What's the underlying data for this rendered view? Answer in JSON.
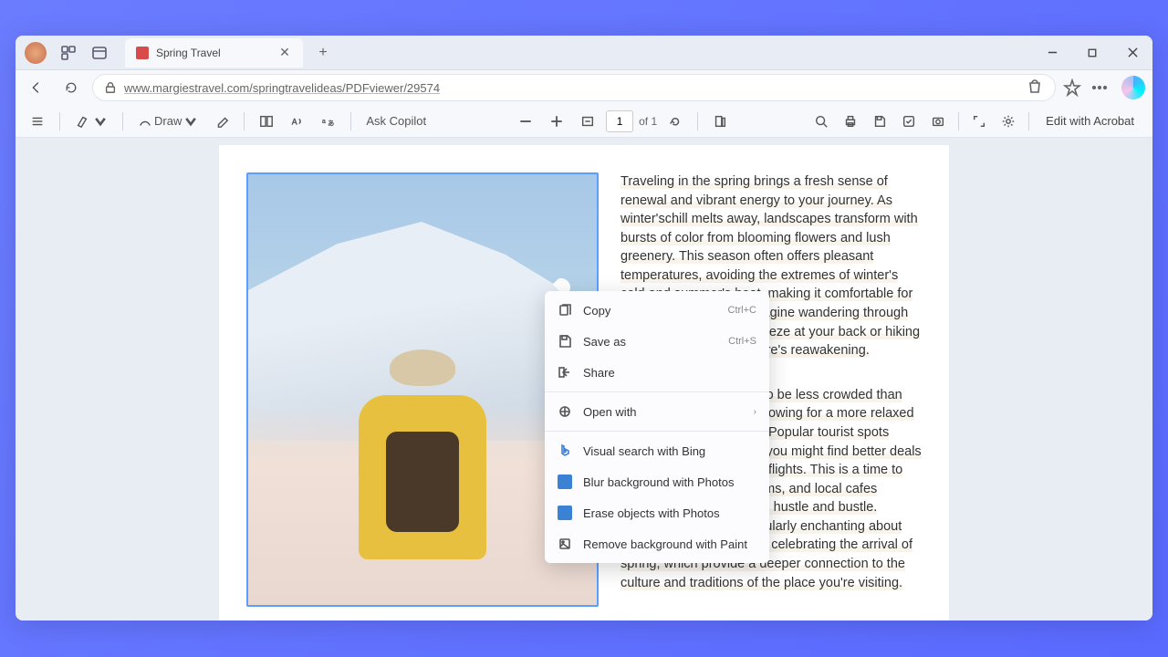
{
  "tab": {
    "title": "Spring Travel"
  },
  "url": "www.margiestravel.com/springtravelideas/PDFviewer/29574",
  "toolbar": {
    "draw_label": "Draw",
    "ask_copilot": "Ask Copilot",
    "page_current": "1",
    "page_of": "of 1",
    "edit_acrobat": "Edit with Acrobat"
  },
  "document": {
    "para1": "Traveling in the spring brings a fresh sense of renewal and vibrant energy to your journey. As winter'schill melts away, landscapes transform with bursts of color from blooming flowers and lush greenery. This season often offers pleasant temperatures, avoiding the extremes of winter's cold and summer's heat, making it comfortable for outdoor explorations. Imagine wandering through gardens with a gentle breeze at your back or hiking trails surrounded by nature's reawakening.",
    "para2": "Spring travel also tends to be less crowded than peak summer months, allowing for a more relaxed and intimate experience. Popular tourist spots become accessible, and you might find better deals on accommodations and flights. This is a time to enjoy attractions, museums, and local cafes without the overwhelming hustle and bustle. There's something particularly enchanting about local festivals and events celebrating the arrival of spring, which provide a deeper connection to the culture and traditions of the place you're visiting."
  },
  "ctx": {
    "copy": "Copy",
    "copy_sc": "Ctrl+C",
    "save": "Save as",
    "save_sc": "Ctrl+S",
    "share": "Share",
    "open_with": "Open with",
    "visual_search": "Visual search with Bing",
    "blur": "Blur background with Photos",
    "erase": "Erase objects with Photos",
    "remove_bg": "Remove background with Paint"
  }
}
